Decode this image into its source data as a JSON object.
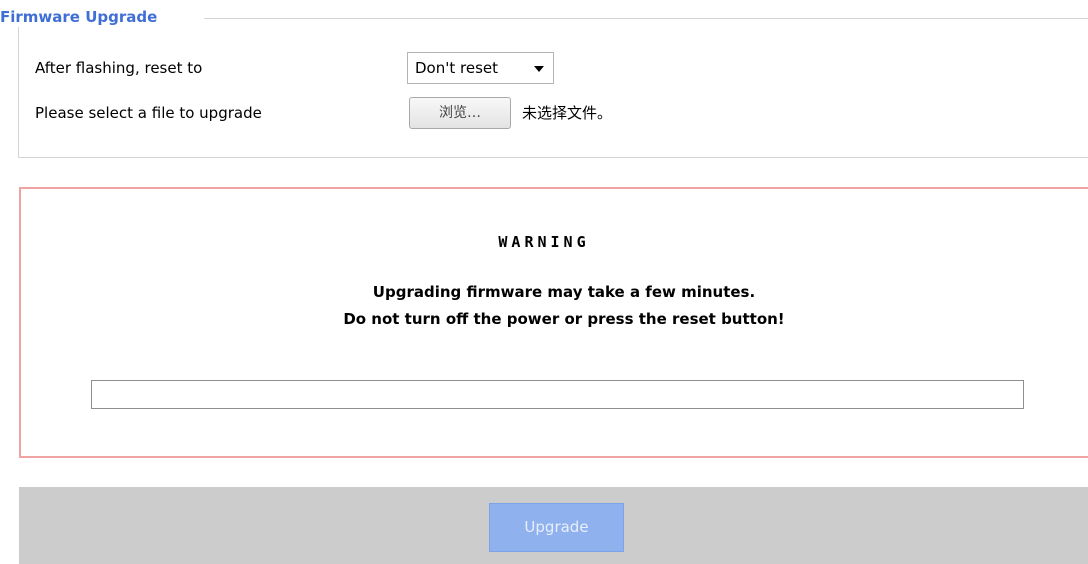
{
  "section": {
    "legend": "Firmware Upgrade",
    "reset_label": "After flashing, reset to",
    "reset_select": {
      "selected": "Don't reset"
    },
    "file_label": "Please select a file to upgrade",
    "browse_button": "浏览…",
    "file_status": "未选择文件。"
  },
  "warning": {
    "title": "WARNING",
    "line1": "Upgrading firmware may take a few minutes.",
    "line2": "Do not turn off the power or press the reset button!",
    "progress_percent": 0
  },
  "actions": {
    "upgrade_button": "Upgrade"
  },
  "colors": {
    "legend_accent": "#3f6fd6",
    "warning_border": "#f0a3a3",
    "action_bar": "#cccccc",
    "upgrade_button_disabled": "#8fb1ee"
  },
  "icons": {
    "select_arrow": "chevron-down-icon"
  }
}
